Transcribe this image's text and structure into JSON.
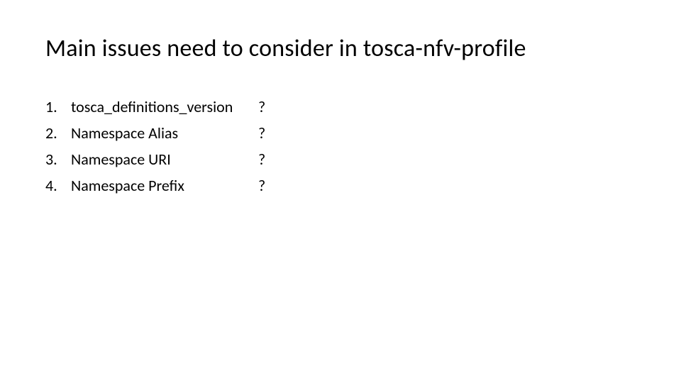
{
  "title": "Main issues need to consider in tosca-nfv-profile",
  "items": [
    {
      "num": "1.",
      "text": "tosca_definitions_version",
      "mark": "?"
    },
    {
      "num": "2.",
      "text": "Namespace Alias",
      "mark": "?"
    },
    {
      "num": "3.",
      "text": "Namespace URI",
      "mark": "?"
    },
    {
      "num": "4.",
      "text": "Namespace Prefix",
      "mark": "?"
    }
  ]
}
